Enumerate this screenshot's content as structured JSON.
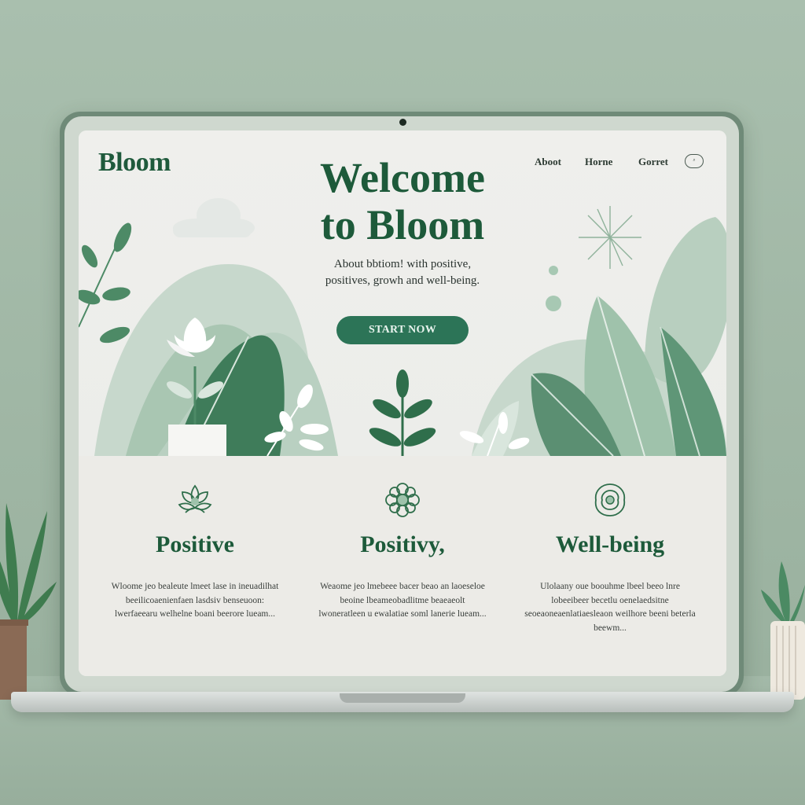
{
  "header": {
    "logo": "Bloom",
    "nav": [
      "Aboot",
      "Horne",
      "Gorret"
    ],
    "nav_button": "⌕"
  },
  "hero": {
    "title_line1": "Welcome",
    "title_line2": "to Bloom",
    "subtitle_line1": "About bbtiom! with positive,",
    "subtitle_line2": "positives, growh and well-being.",
    "cta_label": "START NOW"
  },
  "features": [
    {
      "title": "Positive",
      "icon": "lotus-icon",
      "text": "Wloome jeo bealeute lmeet lase in ineuadilhat beeilicoaenienfaen lasdsiv benseuoon: lwerfaeearu welhelne boani beerore lueam..."
    },
    {
      "title": "Positivy,",
      "icon": "flower-icon",
      "text": "Weaome jeo lmebeee bacer beao an laoeseloe beoine lbeameobadlitme beaeaeolt lwoneratleen u ewalatiae soml lanerie lueam..."
    },
    {
      "title": "Well-being",
      "icon": "rose-icon",
      "text": "Ulolaany oue boouhme lbeel beeo lnre lobeeibeer becetlu oenelaedsitne seoeaoneaenlatiaesleaon weilhore beeni beterla beewm..."
    }
  ],
  "colors": {
    "brand": "#1d5a3a",
    "cta": "#2c7457",
    "leaf_dark": "#3f7c5a",
    "leaf_light": "#9cbfa8",
    "background": "#a9bfae"
  }
}
